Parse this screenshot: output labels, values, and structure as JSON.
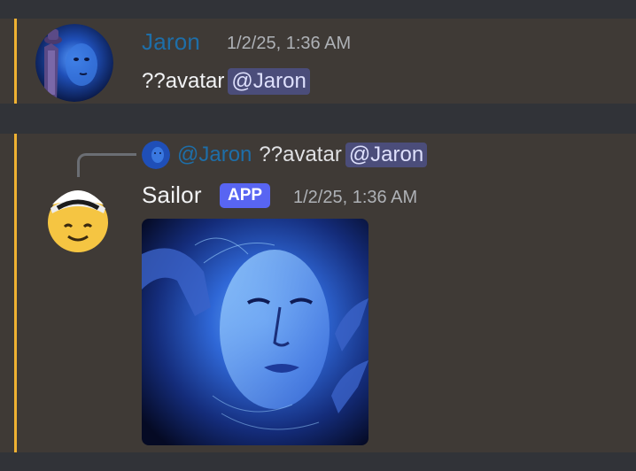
{
  "messages": [
    {
      "username": "Jaron",
      "timestamp": "1/2/25, 1:36 AM",
      "text": "??avatar",
      "mention": "@Jaron"
    },
    {
      "username": "Sailor",
      "badge": "APP",
      "timestamp": "1/2/25, 1:36 AM",
      "reply": {
        "username": "@Jaron",
        "text": "??avatar",
        "mention": "@Jaron"
      },
      "attachment": "avatar-image"
    }
  ],
  "colors": {
    "background": "#313338",
    "highlight_bg": "#3f3a36",
    "accent_bar": "#f0b232",
    "jaron_name": "#1e6ea8",
    "mention_bg": "#4b4d7a",
    "app_badge": "#5865f2"
  },
  "icons": {
    "jaron_avatar": "blue-face-avatar-with-hat",
    "sailor_avatar": "sailor-emoji-avatar"
  }
}
